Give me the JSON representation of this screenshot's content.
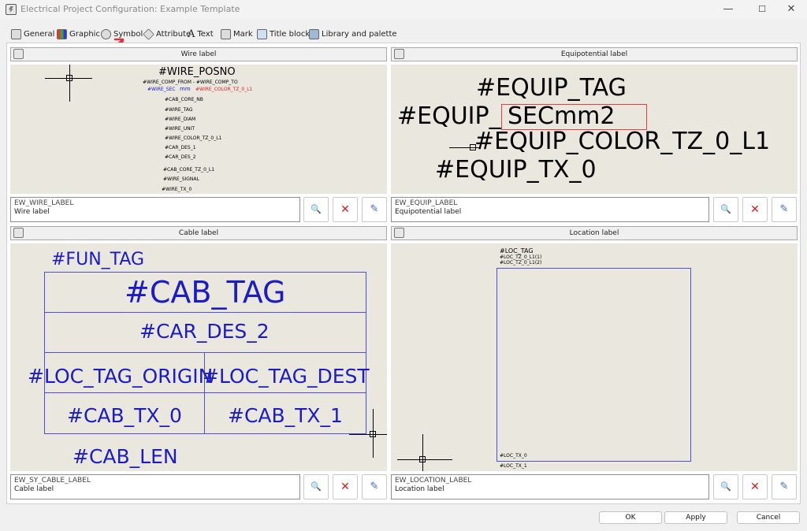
{
  "window": {
    "title": "Electrical Project Configuration: Example Template",
    "minimize": "—",
    "maximize": "☐",
    "close": "✕"
  },
  "tabs": [
    {
      "label": "General",
      "icon": "general-icon"
    },
    {
      "label": "Graphic",
      "icon": "graphic-icon"
    },
    {
      "label": "Symbol",
      "icon": "symbol-icon",
      "active": true
    },
    {
      "label": "Attribute",
      "icon": "attribute-icon"
    },
    {
      "label": "Text",
      "icon": "text-icon"
    },
    {
      "label": "Mark",
      "icon": "mark-icon"
    },
    {
      "label": "Title block",
      "icon": "title-block-icon"
    },
    {
      "label": "Library and palette",
      "icon": "library-icon"
    }
  ],
  "wire": {
    "header": "Wire label",
    "code": "EW_WIRE_LABEL",
    "desc": "Wire label",
    "lines": {
      "posno": "#WIRE_POSNO",
      "comp": "#WIRE_COMP_FROM - #WIRE_COMP_TO",
      "sec": "#WIRE_SEC",
      "mm": "mm",
      "color": "#WIRE_COLOR_TZ_0_L1",
      "core_nb": "#CAB_CORE_NB",
      "tag": "#WIRE_TAG",
      "diam": "#WIRE_DIAM",
      "unit": "#WIRE_UNIT",
      "color2": "#WIRE_COLOR_TZ_0_L1",
      "car1": "#CAR_DES_1",
      "car2": "#CAR_DES_2",
      "core_tz": "#CAB_CORE_TZ_0_L1",
      "signal": "#WIRE_SIGNAL",
      "tx": "#WIRE_TX_0"
    }
  },
  "equip": {
    "header": "Equipotential label",
    "code": "EW_EQUIP_LABEL",
    "desc": "Equipotential label",
    "tag": "#EQUIP_TAG",
    "sec_left": "#EQUIP_",
    "sec_right": "SECmm2",
    "color": "#EQUIP_COLOR_TZ_0_L1",
    "tx": "#EQUIP_TX_0"
  },
  "cable": {
    "header": "Cable label",
    "code": "EW_SY_CABLE_LABEL",
    "desc": "Cable label",
    "fun_tag": "#FUN_TAG",
    "cab_tag": "#CAB_TAG",
    "car_des": "#CAR_DES_2",
    "loc_origin": "#LOC_TAG_ORIGIN",
    "loc_dest": "#LOC_TAG_DEST",
    "tx0": "#CAB_TX_0",
    "tx1": "#CAB_TX_1",
    "len": "#CAB_LEN"
  },
  "location": {
    "header": "Location label",
    "code": "EW_LOCATION_LABEL",
    "desc": "Location label",
    "tag": "#LOC_TAG",
    "tz1": "#LOC_TZ_0_L1(1)",
    "tz2": "#LOC_TZ_0_L1(2)",
    "tx0": "#LOC_TX_0",
    "tx1": "#LOC_TX_1"
  },
  "buttons": {
    "ok": "OK",
    "apply": "Apply",
    "cancel": "Cancel",
    "view": "🔍",
    "delete": "✕",
    "edit": "✎"
  },
  "annotation": {
    "arrow_color": "#e0303a"
  }
}
